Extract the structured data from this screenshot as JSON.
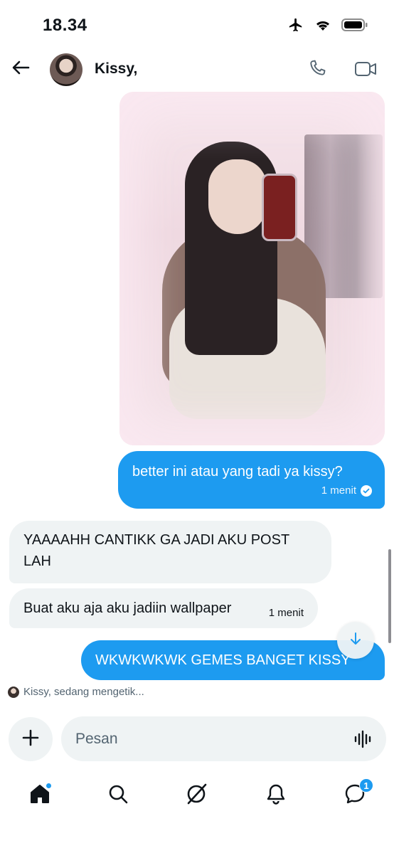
{
  "status_bar": {
    "time": "18.34",
    "icons": [
      "airplane-icon",
      "wifi-icon",
      "battery-icon"
    ]
  },
  "header": {
    "back_icon": "arrow-left-icon",
    "contact_name": "Kissy,",
    "call_icon": "phone-icon",
    "video_icon": "video-camera-icon"
  },
  "messages": [
    {
      "type": "image",
      "direction": "sent",
      "description_icon": "photo"
    },
    {
      "type": "text",
      "direction": "sent",
      "text": "better ini atau yang tadi ya kissy?",
      "time": "1 menit",
      "status_icon": "check-circle-icon"
    },
    {
      "type": "text",
      "direction": "received",
      "text": "YAAAAHH CANTIKK GA JADI AKU POST LAH"
    },
    {
      "type": "text",
      "direction": "received",
      "text": "Buat aku aja aku jadiin wallpaper",
      "time": "1 menit"
    },
    {
      "type": "text",
      "direction": "sent",
      "text": "WKWKWKWK GEMES BANGET KISSY"
    }
  ],
  "typing_indicator": "Kissy, sedang mengetik...",
  "composer": {
    "placeholder": "Pesan",
    "add_icon": "plus-icon",
    "voice_icon": "voice-wave-icon"
  },
  "nav": {
    "items": [
      {
        "name": "home",
        "icon": "home-icon",
        "has_dot": true
      },
      {
        "name": "search",
        "icon": "search-icon"
      },
      {
        "name": "grok",
        "icon": "grok-icon"
      },
      {
        "name": "notifications",
        "icon": "bell-icon"
      },
      {
        "name": "messages",
        "icon": "message-icon",
        "badge": "1"
      }
    ]
  },
  "colors": {
    "accent": "#1d9bf0",
    "received_bubble": "#eff3f4",
    "text": "#0f1419",
    "muted": "#536471"
  }
}
